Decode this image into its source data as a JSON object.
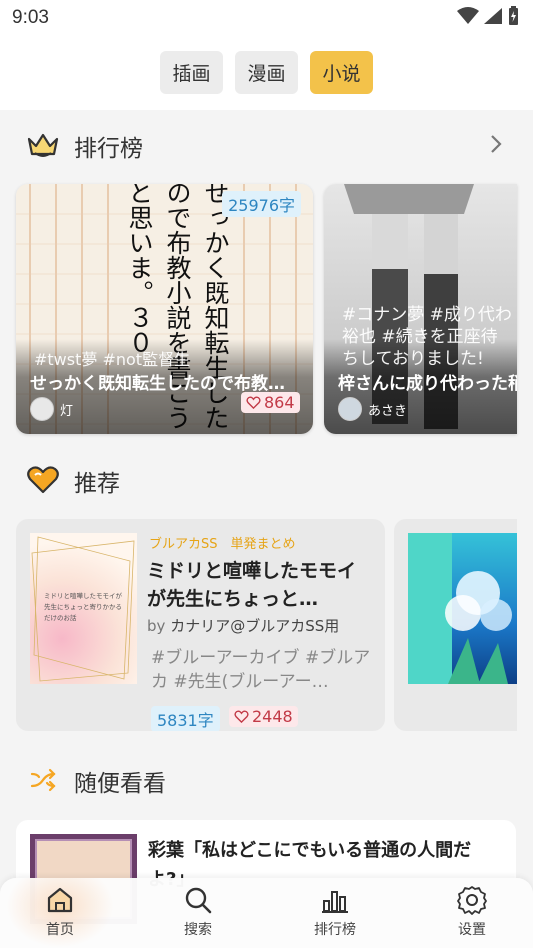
{
  "status": {
    "time": "9:03"
  },
  "category_tabs": [
    {
      "label": "插画",
      "active": false
    },
    {
      "label": "漫画",
      "active": false
    },
    {
      "label": "小说",
      "active": true
    }
  ],
  "ranking": {
    "title": "排行榜",
    "icon": "crown-icon",
    "cards": [
      {
        "char_count": "25976字",
        "cover_text": "せっかく既知転生したので布教小説を書こうと思いま。３０",
        "tags": "#twst夢 #not監督生",
        "title": "せっかく既知転生したので布教…",
        "author": "灯",
        "likes": "864"
      },
      {
        "tags": "#コナン夢 #成り代わ",
        "tags_line2": "裕也 #続きを正座待",
        "tags_line3": "ちしておりました!",
        "title": "梓さんに成り代わった稍",
        "author": "あさき"
      }
    ]
  },
  "recommend": {
    "title": "推荐",
    "icon": "heart-icon",
    "cards": [
      {
        "category": "ブルアカSS　単発まとめ",
        "title": "ミドリと喧嘩したモモイが先生にちょっと…",
        "by": "by",
        "author": "カナリア@ブルアカSS用",
        "tags": "#ブルーアーカイブ #ブルアカ #先生(ブルーアー…",
        "cover_text": "ミドリと喧嘩したモモイが先生にちょっと寄りかかるだけのお話",
        "char_count": "5831字",
        "likes": "2448"
      }
    ]
  },
  "random": {
    "title": "随便看看",
    "icon": "shuffle-icon",
    "items": [
      {
        "title": "彩葉「私はどこにでもいる普通の人間だよ?」"
      }
    ]
  },
  "bottom_nav": [
    {
      "label": "首页",
      "icon": "home-icon",
      "active": true
    },
    {
      "label": "搜索",
      "icon": "search-icon",
      "active": false
    },
    {
      "label": "排行榜",
      "icon": "bar-chart-icon",
      "active": false
    },
    {
      "label": "设置",
      "icon": "gear-icon",
      "active": false
    }
  ],
  "colors": {
    "accent": "#f3c24a",
    "char_badge_text": "#2e86c1",
    "like_badge_text": "#c23a47",
    "category_text": "#e6a417"
  }
}
